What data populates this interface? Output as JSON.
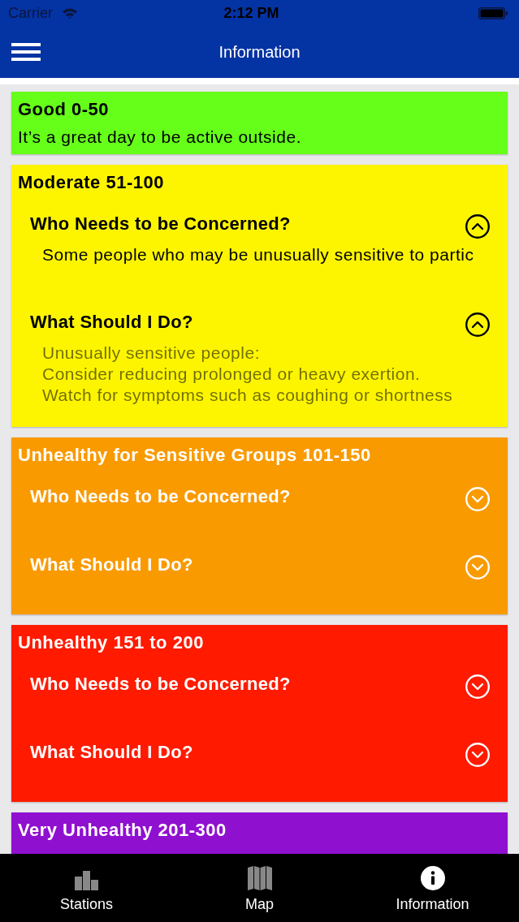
{
  "status_bar": {
    "carrier": "Carrier",
    "time": "2:12 PM"
  },
  "nav_bar": {
    "title": "Information"
  },
  "categories": [
    {
      "title": "Good 0-50",
      "color": "#66ff1a",
      "description": "It’s a great day to be active outside."
    },
    {
      "title": "Moderate 51-100",
      "color": "#fdf500",
      "sections": [
        {
          "title": "Who Needs to be Concerned?",
          "expanded": true,
          "body": {
            "lines": [
              "Some people who may be unusually sensitive to partic"
            ],
            "dimmed": false
          }
        },
        {
          "title": "What Should I Do?",
          "expanded": true,
          "body": {
            "lines": [
              "Unusually sensitive people:",
              "Consider reducing prolonged or heavy exertion.",
              "Watch for symptoms such as coughing or shortness"
            ],
            "dimmed": true
          }
        }
      ]
    },
    {
      "title": "Unhealthy for Sensitive Groups 101-150",
      "color": "#f99a00",
      "sections": [
        {
          "title": "Who Needs to be Concerned?",
          "expanded": false
        },
        {
          "title": "What Should I Do?",
          "expanded": false
        }
      ]
    },
    {
      "title": "Unhealthy 151 to 200",
      "color": "#ff1a00",
      "sections": [
        {
          "title": "Who Needs to be Concerned?",
          "expanded": false
        },
        {
          "title": "What Should I Do?",
          "expanded": false
        }
      ]
    },
    {
      "title": "Very Unhealthy 201-300",
      "color": "#9010d0"
    }
  ],
  "tabs": [
    {
      "label": "Stations",
      "kind": "chart",
      "selected": false
    },
    {
      "label": "Map",
      "kind": "map",
      "selected": false
    },
    {
      "label": "Information",
      "kind": "info",
      "selected": true
    }
  ]
}
